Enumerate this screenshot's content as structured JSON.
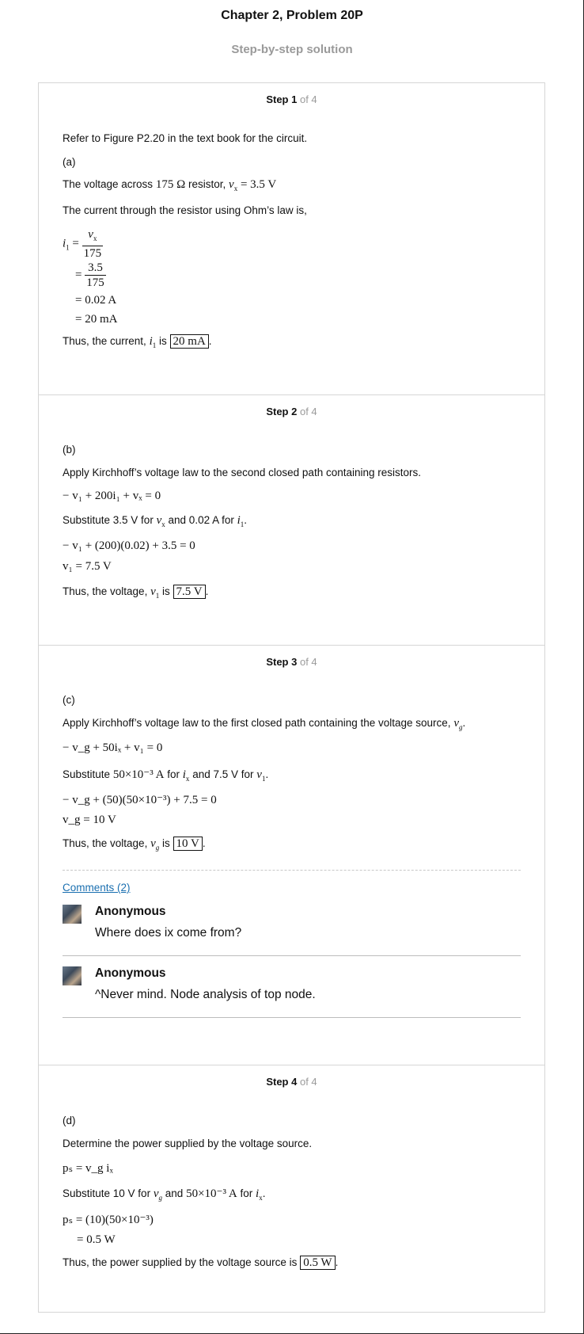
{
  "header": {
    "title": "Chapter 2, Problem 20P",
    "subtitle": "Step-by-step solution"
  },
  "steps": [
    {
      "label": "Step 1",
      "of": "of 4",
      "intro": "Refer to Figure P2.20 in the text book for the circuit.",
      "part": "(a)",
      "text1": "The voltage across",
      "resistance": "175 Ω",
      "text2": "resistor,",
      "vx_eq": "= 3.5 V",
      "text3": "The current through the resistor using Ohm’s law is,",
      "eq_lhs": "= ",
      "frac1_num": "v",
      "frac1_den": "175",
      "frac2_num": "3.5",
      "frac2_den": "175",
      "res1": "= 0.02 A",
      "res2": "= 20 mA",
      "concl_pre": "Thus, the current,",
      "concl_is": "is",
      "answer": "20 mA"
    },
    {
      "label": "Step 2",
      "of": "of 4",
      "part": "(b)",
      "text1": "Apply Kirchhoff’s voltage law to the second closed path containing resistors.",
      "eq1": "− v₁ + 200i₁ + vₓ = 0",
      "sub_pre": "Substitute 3.5 V for",
      "sub_mid": "and 0.02 A for",
      "eq2": "− v₁ + (200)(0.02) + 3.5 = 0",
      "eq3": "v₁ = 7.5 V",
      "concl_pre": "Thus, the voltage,",
      "concl_is": "is",
      "answer": "7.5 V"
    },
    {
      "label": "Step 3",
      "of": "of 4",
      "part": "(c)",
      "text1": "Apply Kirchhoff’s voltage law to the first closed path containing the voltage source,",
      "eq1": "− v_g + 50iₓ + v₁ = 0",
      "sub_pre": "Substitute",
      "sub_val": "50×10⁻³ A",
      "sub_for": "for",
      "sub_mid": "and 7.5 V for",
      "eq2": "− v_g + (50)(50×10⁻³) + 7.5 = 0",
      "eq3": "v_g = 10 V",
      "concl_pre": "Thus, the voltage,",
      "concl_is": "is",
      "answer": "10 V",
      "comments_link": "Comments (2)",
      "comments": [
        {
          "author": "Anonymous",
          "text": "Where does ix come from?"
        },
        {
          "author": "Anonymous",
          "text": "^Never mind. Node analysis of top node."
        }
      ]
    },
    {
      "label": "Step 4",
      "of": "of 4",
      "part": "(d)",
      "text1": "Determine the power supplied by the voltage source.",
      "eq1": "pₛ = v_g iₓ",
      "sub_pre": "Substitute 10 V for",
      "sub_and": "and",
      "sub_val": "50×10⁻³ A",
      "sub_for": "for",
      "eq2": "pₛ = (10)(50×10⁻³)",
      "eq3": "= 0.5 W",
      "concl_pre": "Thus, the power supplied by the voltage source is",
      "answer": "0.5 W"
    }
  ]
}
